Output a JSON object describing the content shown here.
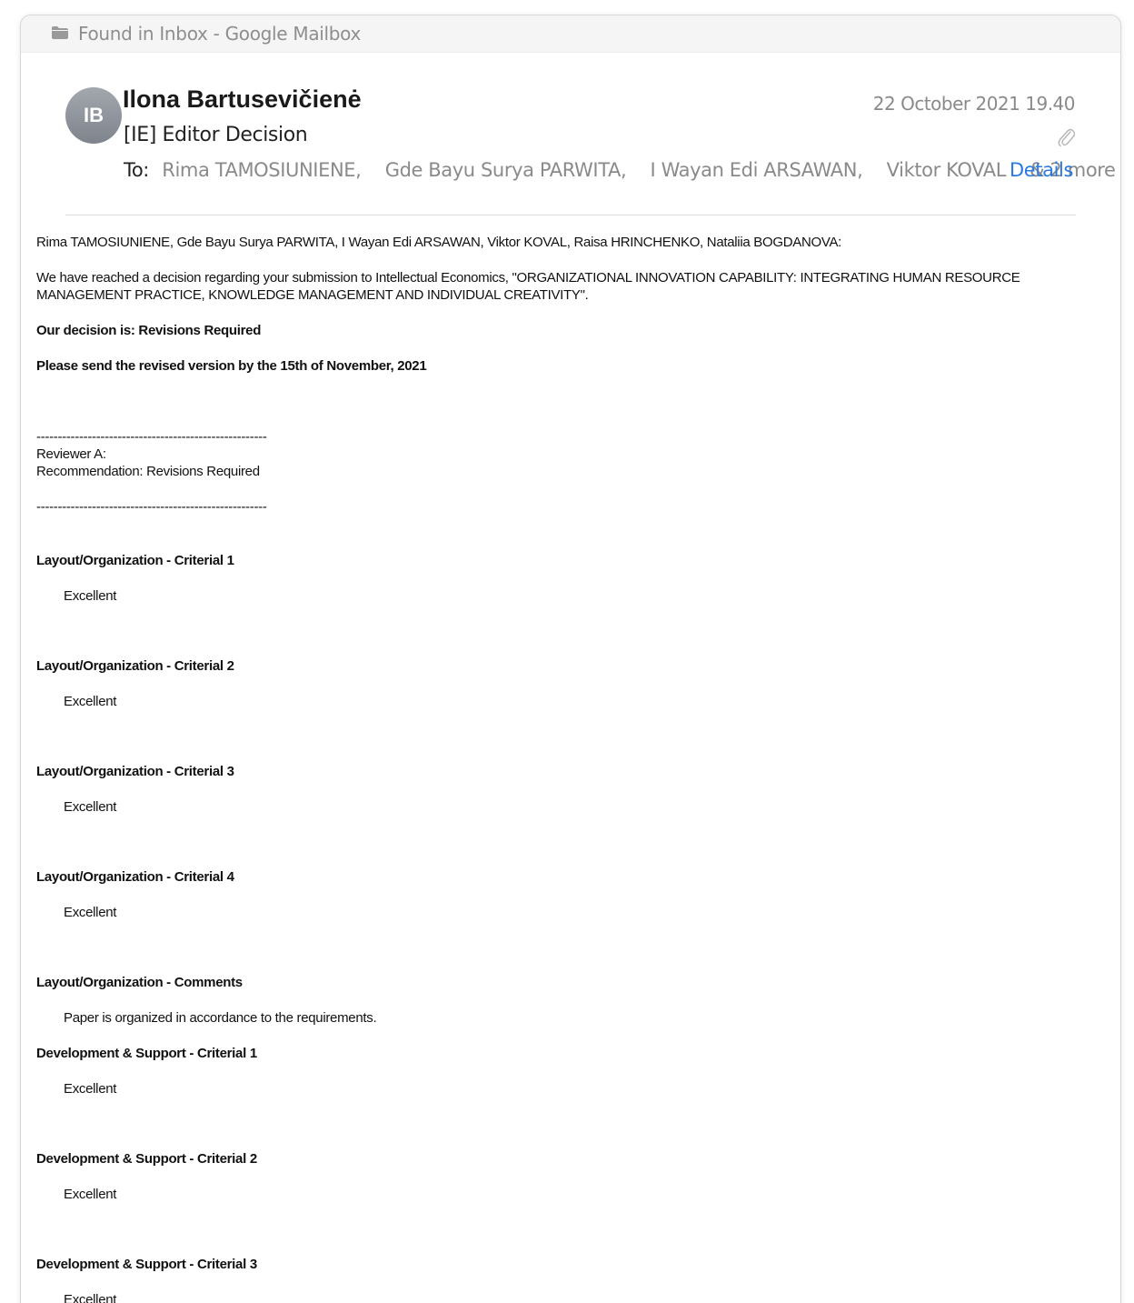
{
  "mailbox": {
    "label": "Found in Inbox - Google Mailbox",
    "icon": "folder-icon"
  },
  "message": {
    "avatar_initials": "IB",
    "sender": "Ilona Bartusevičienė",
    "subject": "[IE] Editor Decision",
    "to_label": "To:",
    "recipients": [
      "Rima TAMOSIUNIENE,",
      "Gde Bayu Surya PARWITA,",
      "I Wayan Edi ARSAWAN,",
      "Viktor KOVAL"
    ],
    "more": "& 2 more",
    "date": "22 October 2021 19.40",
    "details_label": "Details",
    "attachment_icon": "paperclip-icon"
  },
  "body": {
    "addressees": "Rima TAMOSIUNIENE, Gde Bayu Surya PARWITA, I Wayan Edi ARSAWAN, Viktor KOVAL, Raisa HRINCHENKO, Nataliia BOGDANOVA:",
    "intro": "We have reached a decision regarding your submission to Intellectual Economics, \"ORGANIZATIONAL INNOVATION CAPABILITY: INTEGRATING HUMAN RESOURCE MANAGEMENT PRACTICE, KNOWLEDGE MANAGEMENT AND INDIVIDUAL CREATIVITY\".",
    "decision": "Our decision is: Revisions Required",
    "deadline": "Please send the revised version by the 15th of November, 2021",
    "separator": "------------------------------------------------------",
    "reviewer": "Reviewer A:",
    "recommendation": "Recommendation: Revisions Required",
    "sections": [
      {
        "heading": "Layout/Organization - Criterial 1",
        "value": "Excellent"
      },
      {
        "heading": "Layout/Organization - Criterial 2",
        "value": "Excellent"
      },
      {
        "heading": "Layout/Organization - Criterial 3",
        "value": "Excellent"
      },
      {
        "heading": "Layout/Organization - Criterial 4",
        "value": "Excellent"
      },
      {
        "heading": "Layout/Organization - Comments",
        "value": "Paper is organized in accordance to the requirements."
      },
      {
        "heading": "Development & Support - Criterial 1",
        "value": "Excellent"
      },
      {
        "heading": "Development & Support - Criterial 2",
        "value": "Excellent"
      },
      {
        "heading": "Development & Support - Criterial 3",
        "value": "Excellent"
      }
    ]
  }
}
